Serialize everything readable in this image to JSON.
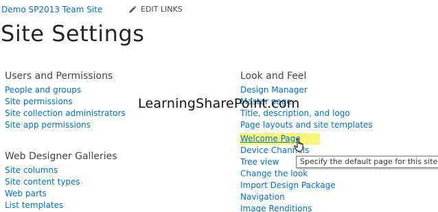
{
  "header": {
    "site_link": "Demo SP2013 Team Site",
    "edit_links": "EDIT LINKS",
    "edit_icon": "pencil-icon"
  },
  "page_title": "Site Settings",
  "sections": {
    "users_permissions": {
      "heading": "Users and Permissions",
      "items": [
        "People and groups",
        "Site permissions",
        "Site collection administrators",
        "Site app permissions"
      ]
    },
    "web_designer_galleries": {
      "heading": "Web Designer Galleries",
      "items": [
        "Site columns",
        "Site content types",
        "Web parts",
        "List templates"
      ]
    },
    "look_and_feel": {
      "heading": "Look and Feel",
      "items": [
        "Design Manager",
        "Master page",
        "Title, description, and logo",
        "Page layouts and site templates",
        "Welcome Page",
        "Device Channels",
        "Tree view",
        "Change the look",
        "Import Design Package",
        "Navigation",
        "Image Renditions"
      ]
    }
  },
  "watermark": "LearningSharePoint.com",
  "tooltip": "Specify the default page for this site.",
  "cursor_icon": "hand-pointer-icon",
  "colors": {
    "link": "#0072c6",
    "heading": "#444444",
    "title": "#262626",
    "highlight": "#f8f57a"
  }
}
